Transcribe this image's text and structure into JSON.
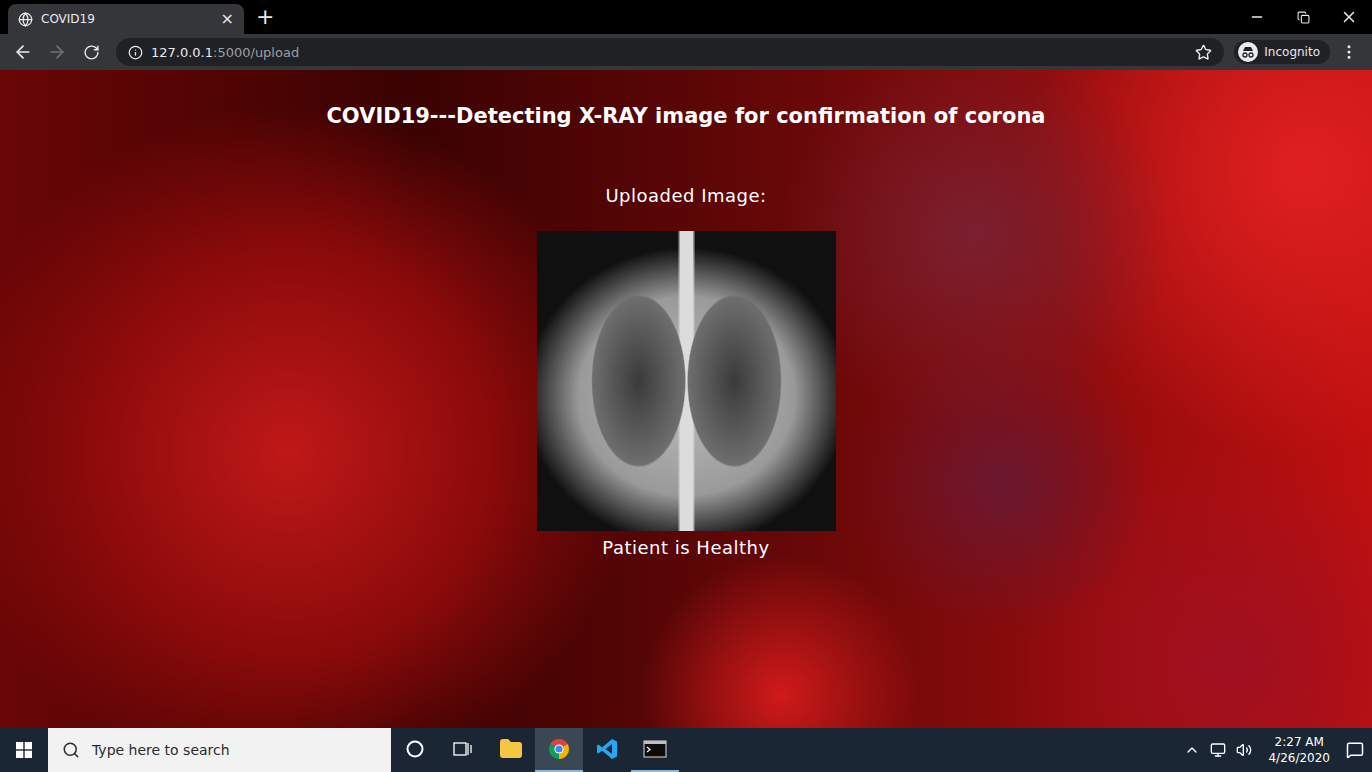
{
  "window": {
    "title": "COVID19"
  },
  "tabs": [
    {
      "label": "COVID19",
      "selected": true,
      "close": "×"
    }
  ],
  "new_tab": "+",
  "navigation": {
    "back_enabled": true,
    "forward_enabled": false
  },
  "address_bar": {
    "host": "127.0.0.1",
    "path": ":5000/upload"
  },
  "profile": {
    "label": "Incognito"
  },
  "page": {
    "title": "COVID19---Detecting X-RAY image for confirmation of corona",
    "subtitle": "Uploaded Image:",
    "result": "Patient is Healthy"
  },
  "taskbar": {
    "search_placeholder": "Type here to search",
    "apps": [
      {
        "kind": "explorer",
        "selected": false,
        "running": false
      },
      {
        "kind": "chrome",
        "selected": true,
        "running": true
      },
      {
        "kind": "vscode",
        "selected": false,
        "running": false
      },
      {
        "kind": "terminal",
        "selected": false,
        "running": true
      }
    ],
    "time": "2:27 AM",
    "date": "4/26/2020"
  }
}
